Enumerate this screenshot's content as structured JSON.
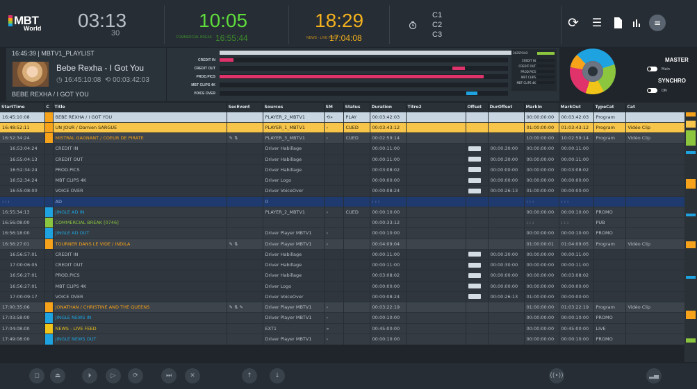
{
  "header": {
    "logo_main": "MBT",
    "logo_sub": "World",
    "clock1": "03:13",
    "clock1_sub": "30",
    "clock2": "10:05",
    "clock2_label": "COMMERCIAL BREAK",
    "clock2_time": "16:55:44",
    "clock3": "18:29",
    "clock3_label": "NEWS - LIVE FEED",
    "clock3_time": "17:04:08",
    "channels": [
      "C1",
      "C2",
      "C3"
    ],
    "master": "MASTER",
    "main": "Main",
    "synchro": "SYNCHRO",
    "on": "ON"
  },
  "nowplaying": {
    "head": "16:45:39 | MBTV1_PLAYLIST",
    "title": "Bebe Rexha - I Got You",
    "start": "16:45:10:08",
    "duration": "00:03:42:03",
    "footer": "BEBE REXHA / I GOT YOU"
  },
  "timeline": {
    "labels": [
      "CREDIT IN",
      "CREDIT OUT",
      "PROD.PICS",
      "MBT CLIPS 4K",
      "VOICE OVER"
    ]
  },
  "panel": {
    "head": "3625PCHO",
    "labels": [
      "CREDIT IN",
      "CREDIT OUT",
      "PROD.PICS",
      "MBT CLIPS",
      "MBT CLIPS 4K"
    ]
  },
  "columns": [
    "StartTime",
    "C",
    "Title",
    "SecEvent",
    "Sources",
    "SM",
    "Status",
    "Duration",
    "Titre2",
    "Offset",
    "DurOffset",
    "MarkIn",
    "MarkOut",
    "TypeCat",
    "Cat"
  ],
  "rows": [
    {
      "k": "play",
      "t": "16:45:10:08",
      "c": "#f6a21a",
      "title": "BEBE REXHA / I GOT YOU",
      "sec": "",
      "src": "PLAYER_2_MBTV1",
      "sm": "⟲»",
      "st": "PLAY",
      "dur": "00:03:42:03",
      "off": "",
      "doff": "",
      "mi": "00:00:00:00",
      "mo": "00:03:42:03",
      "tc": "Program",
      "cat": ""
    },
    {
      "k": "cued",
      "t": "16:48:52:11",
      "c": "#f6a21a",
      "title": "UN JOUR / Damien SARGUE",
      "sec": "",
      "src": "PLAYER_1_MBTV1",
      "sm": "›",
      "st": "CUED",
      "dur": "00:03:43:12",
      "off": "",
      "doff": "",
      "mi": "01:00:00:00",
      "mo": "01:03:43:12",
      "tc": "Program",
      "cat": "Vidéo Clip"
    },
    {
      "k": "top",
      "t": "16:52:34:24",
      "c": "#f6a21a",
      "title": "MISTRAL GAGNANT / COEUR DE PIRATE",
      "sec": "✎ ⇅",
      "src": "PLAYER_3_MBTV1",
      "sm": "›",
      "st": "CUED",
      "dur": "00:02:59:14",
      "off": "",
      "doff": "",
      "mi": "10:00:00:00",
      "mo": "10:02:59:14",
      "tc": "Program",
      "cat": "Vidéo Clip",
      "tcol": "#f6a21a"
    },
    {
      "k": "sub",
      "t": "16:53:04:24",
      "c": "",
      "title": "CREDIT IN",
      "sec": "",
      "src": "Driver Habillage",
      "sm": "",
      "st": "",
      "dur": "00:00:11:00",
      "off": "b",
      "doff": "00:00:30:00",
      "mi": "00:00:00:00",
      "mo": "00:00:11:00",
      "tc": "",
      "cat": ""
    },
    {
      "k": "sub",
      "t": "16:55:04:13",
      "c": "",
      "title": "CREDIT OUT",
      "sec": "",
      "src": "Driver Habillage",
      "sm": "",
      "st": "",
      "dur": "00:00:11:00",
      "off": "b",
      "doff": "00:00:30:00",
      "mi": "00:00:00:00",
      "mo": "00:00:11:00",
      "tc": "",
      "cat": ""
    },
    {
      "k": "sub",
      "t": "16:52:34:24",
      "c": "",
      "title": "PROD.PICS",
      "sec": "",
      "src": "Driver Habillage",
      "sm": "",
      "st": "",
      "dur": "00:03:08:02",
      "off": "b",
      "doff": "00:00:00:00",
      "mi": "00:00:00:00",
      "mo": "00:03:08:02",
      "tc": "",
      "cat": ""
    },
    {
      "k": "sub",
      "t": "16:52:34:24",
      "c": "",
      "title": "MBT CLIPS 4K",
      "sec": "",
      "src": "Driver Logo",
      "sm": "",
      "st": "",
      "dur": "00:00:00:00",
      "off": "b",
      "doff": "00:00:00:00",
      "mi": "00:00:00:00",
      "mo": "00:00:00:00",
      "tc": "",
      "cat": ""
    },
    {
      "k": "sub",
      "t": "16:55:08:00",
      "c": "",
      "title": "VOICE OVER",
      "sec": "",
      "src": "Driver VoiceOver",
      "sm": "",
      "st": "",
      "dur": "00:00:08:24",
      "off": "b",
      "doff": "00:00:26:13",
      "mi": "01:00:00:00",
      "mo": "00:00:00:00",
      "tc": "",
      "cat": ""
    },
    {
      "k": "break",
      "t": ": : :",
      "c": "",
      "title": "AD",
      "sec": "",
      "src": "0",
      "sm": "",
      "st": "",
      "dur": ": : :",
      "off": "",
      "doff": "",
      "mi": ": : :",
      "mo": ": : :",
      "tc": "",
      "cat": ""
    },
    {
      "k": "plain",
      "t": "16:55:34:13",
      "c": "#1fa3e0",
      "title": "JINGLE AD IN",
      "sec": "",
      "src": "PLAYER_2_MBTV1",
      "sm": "›",
      "st": "CUED",
      "dur": "00:00:10:00",
      "off": "",
      "doff": "",
      "mi": "00:00:00:00",
      "mo": "00:00:10:00",
      "tc": "PROMO",
      "cat": "",
      "tcol": "#1fa3e0"
    },
    {
      "k": "plain",
      "t": "16:56:08:00",
      "c": "#8cc63f",
      "title": "COMMERCIAL BREAK [0746]",
      "sec": "",
      "src": "",
      "sm": "",
      "st": "",
      "dur": "00:00:33:12",
      "off": "",
      "doff": "",
      "mi": ": : :",
      "mo": ": : :",
      "tc": "PUB",
      "cat": "",
      "tcol": "#8cc63f"
    },
    {
      "k": "plain",
      "t": "16:56:18:00",
      "c": "#1fa3e0",
      "title": "JINGLE AD OUT",
      "sec": "",
      "src": "Driver Player MBTV1",
      "sm": "›",
      "st": "",
      "dur": "00:00:10:00",
      "off": "",
      "doff": "",
      "mi": "00:00:00:00",
      "mo": "00:00:10:00",
      "tc": "PROMO",
      "cat": "",
      "tcol": "#1fa3e0"
    },
    {
      "k": "top",
      "t": "16:56:27:01",
      "c": "#f6a21a",
      "title": "TOURNER DANS LE VIDE / INDILA",
      "sec": "✎ ⇅",
      "src": "Driver Player MBTV1",
      "sm": "›",
      "st": "",
      "dur": "00:04:09:04",
      "off": "",
      "doff": "",
      "mi": "01:00:00:01",
      "mo": "01:04:09:05",
      "tc": "Program",
      "cat": "Vidéo Clip",
      "tcol": "#f6a21a"
    },
    {
      "k": "sub",
      "t": "16:56:57:01",
      "c": "",
      "title": "CREDIT IN",
      "sec": "",
      "src": "Driver Habillage",
      "sm": "",
      "st": "",
      "dur": "00:00:11:00",
      "off": "b",
      "doff": "00:00:30:00",
      "mi": "00:00:00:00",
      "mo": "00:00:11:00",
      "tc": "",
      "cat": ""
    },
    {
      "k": "sub",
      "t": "17:00:06:05",
      "c": "",
      "title": "CREDIT OUT",
      "sec": "",
      "src": "Driver Habillage",
      "sm": "",
      "st": "",
      "dur": "00:00:11:00",
      "off": "b",
      "doff": "00:00:30:00",
      "mi": "00:00:00:00",
      "mo": "00:00:11:00",
      "tc": "",
      "cat": ""
    },
    {
      "k": "sub",
      "t": "16:56:27:01",
      "c": "",
      "title": "PROD.PICS",
      "sec": "",
      "src": "Driver Habillage",
      "sm": "",
      "st": "",
      "dur": "00:03:08:02",
      "off": "b",
      "doff": "00:00:00:00",
      "mi": "00:00:00:00",
      "mo": "00:03:08:02",
      "tc": "",
      "cat": ""
    },
    {
      "k": "sub",
      "t": "16:56:27:01",
      "c": "",
      "title": "MBT CLIPS 4K",
      "sec": "",
      "src": "Driver Logo",
      "sm": "",
      "st": "",
      "dur": "00:00:00:00",
      "off": "b",
      "doff": "00:00:00:00",
      "mi": "00:00:00:00",
      "mo": "00:00:00:00",
      "tc": "",
      "cat": ""
    },
    {
      "k": "sub",
      "t": "17:00:09:17",
      "c": "",
      "title": "VOICE OVER",
      "sec": "",
      "src": "Driver VoiceOver",
      "sm": "",
      "st": "",
      "dur": "00:00:08:24",
      "off": "b",
      "doff": "00:00:26:13",
      "mi": "01:00:00:00",
      "mo": "00:00:00:00",
      "tc": "",
      "cat": ""
    },
    {
      "k": "top",
      "t": "17:00:35:06",
      "c": "#f6a21a",
      "title": "JONATHAN / CHRISTINE AND THE QUEENS",
      "sec": "✎ ⇅ ✎",
      "src": "Driver Player MBTV1",
      "sm": "›",
      "st": "",
      "dur": "00:03:22:19",
      "off": "",
      "doff": "",
      "mi": "01:00:00:00",
      "mo": "01:03:22:19",
      "tc": "Program",
      "cat": "Vidéo Clip",
      "tcol": "#f6a21a"
    },
    {
      "k": "plain",
      "t": "17:03:58:00",
      "c": "#1fa3e0",
      "title": "JINGLE NEWS IN",
      "sec": "",
      "src": "Driver Player MBTV1",
      "sm": "›",
      "st": "",
      "dur": "00:00:10:00",
      "off": "",
      "doff": "",
      "mi": "00:00:00:00",
      "mo": "00:00:10:00",
      "tc": "PROMO",
      "cat": "",
      "tcol": "#1fa3e0"
    },
    {
      "k": "plain",
      "t": "17:04:08:00",
      "c": "#f0c419",
      "title": "NEWS - LIVE FEED",
      "sec": "",
      "src": "EXT1",
      "sm": "»",
      "st": "",
      "dur": "00:45:00:00",
      "off": "",
      "doff": "",
      "mi": "00:00:00:00",
      "mo": "00:45:00:00",
      "tc": "LIVE",
      "cat": "",
      "tcol": "#f0c419"
    },
    {
      "k": "plain",
      "t": "17:49:08:00",
      "c": "#1fa3e0",
      "title": "JINGLE NEWS OUT",
      "sec": "",
      "src": "Driver Player MBTV1",
      "sm": "›",
      "st": "",
      "dur": "00:00:10:00",
      "off": "",
      "doff": "",
      "mi": "00:00:00:00",
      "mo": "00:00:10:00",
      "tc": "PROMO",
      "cat": "",
      "tcol": "#1fa3e0"
    }
  ],
  "controls": [
    "stop-button",
    "eject-button",
    "play-next-button",
    "play-button",
    "loop-button",
    "skip-button",
    "cancel-button",
    "move-up-button",
    "move-down-button"
  ]
}
